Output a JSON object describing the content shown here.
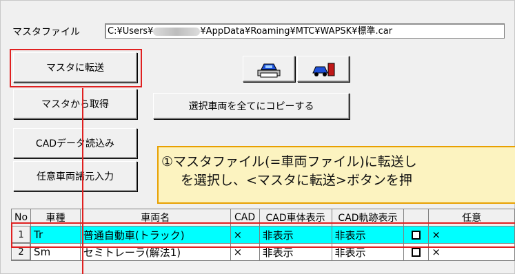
{
  "master_file": {
    "label": "マスタファイル",
    "path_prefix": "C:¥Users¥",
    "path_suffix": "¥AppData¥Roaming¥MTC¥WAPSK¥標準.car"
  },
  "buttons": {
    "transfer": "マスタに転送",
    "fetch": "マスタから取得",
    "copy_all": "選択車両を全てにコピーする",
    "cad_read": "CADデータ読込み",
    "custom_input": "任意車両諸元入力"
  },
  "icons": [
    "print-vehicle-icon",
    "export-vehicle-icon"
  ],
  "callout": {
    "line1": "①マスタファイル(=車両ファイル)に転送し",
    "line2": "を選択し、<マスタに転送>ボタンを押"
  },
  "table": {
    "headers": [
      "No",
      "車種",
      "車両名",
      "CAD",
      "CAD車体表示",
      "CAD軌跡表示",
      "",
      "任意"
    ],
    "rows": [
      {
        "no": "1",
        "type": "Tr",
        "name": "普通自動車(トラック)",
        "cad": "×",
        "body": "非表示",
        "track": "非表示",
        "opt": "×",
        "selected": true
      },
      {
        "no": "2",
        "type": "Sm",
        "name": "セミトレーラ(解法1)",
        "cad": "×",
        "body": "非表示",
        "track": "非表示",
        "opt": "×",
        "selected": false
      }
    ]
  },
  "colors": {
    "highlight": "#e02020",
    "selected_row": "#00ffff",
    "callout_bg": "#fcf3c0",
    "callout_border": "#e8a000"
  }
}
